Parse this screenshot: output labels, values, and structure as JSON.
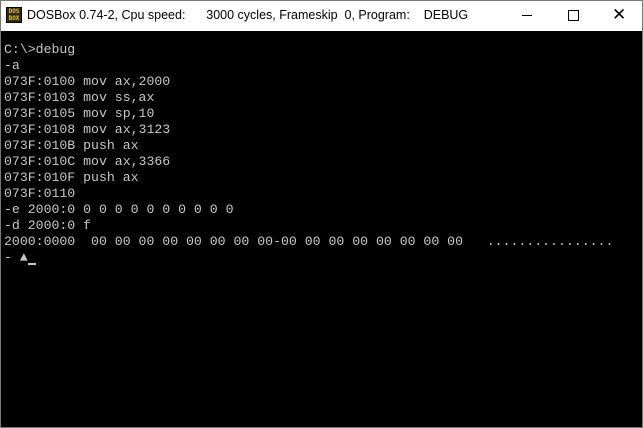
{
  "window": {
    "title": "DOSBox 0.74-2, Cpu speed:      3000 cycles, Frameskip  0, Program:    DEBUG",
    "icon_text": "DOS BOX",
    "minimize_label": "minimize",
    "maximize_label": "maximize",
    "close_glyph": "✕"
  },
  "terminal": {
    "lines": [
      "C:\\>debug",
      "-a",
      "073F:0100 mov ax,2000",
      "073F:0103 mov ss,ax",
      "073F:0105 mov sp,10",
      "073F:0108 mov ax,3123",
      "073F:010B push ax",
      "073F:010C mov ax,3366",
      "073F:010F push ax",
      "073F:0110",
      "-e 2000:0 0 0 0 0 0 0 0 0 0 0",
      "-d 2000:0 f",
      "2000:0000  00 00 00 00 00 00 00 00-00 00 00 00 00 00 00 00   ................",
      "- ▲"
    ]
  },
  "colors": {
    "terminal_bg": "#000000",
    "terminal_fg": "#c8c8c8",
    "titlebar_bg": "#ffffff"
  }
}
